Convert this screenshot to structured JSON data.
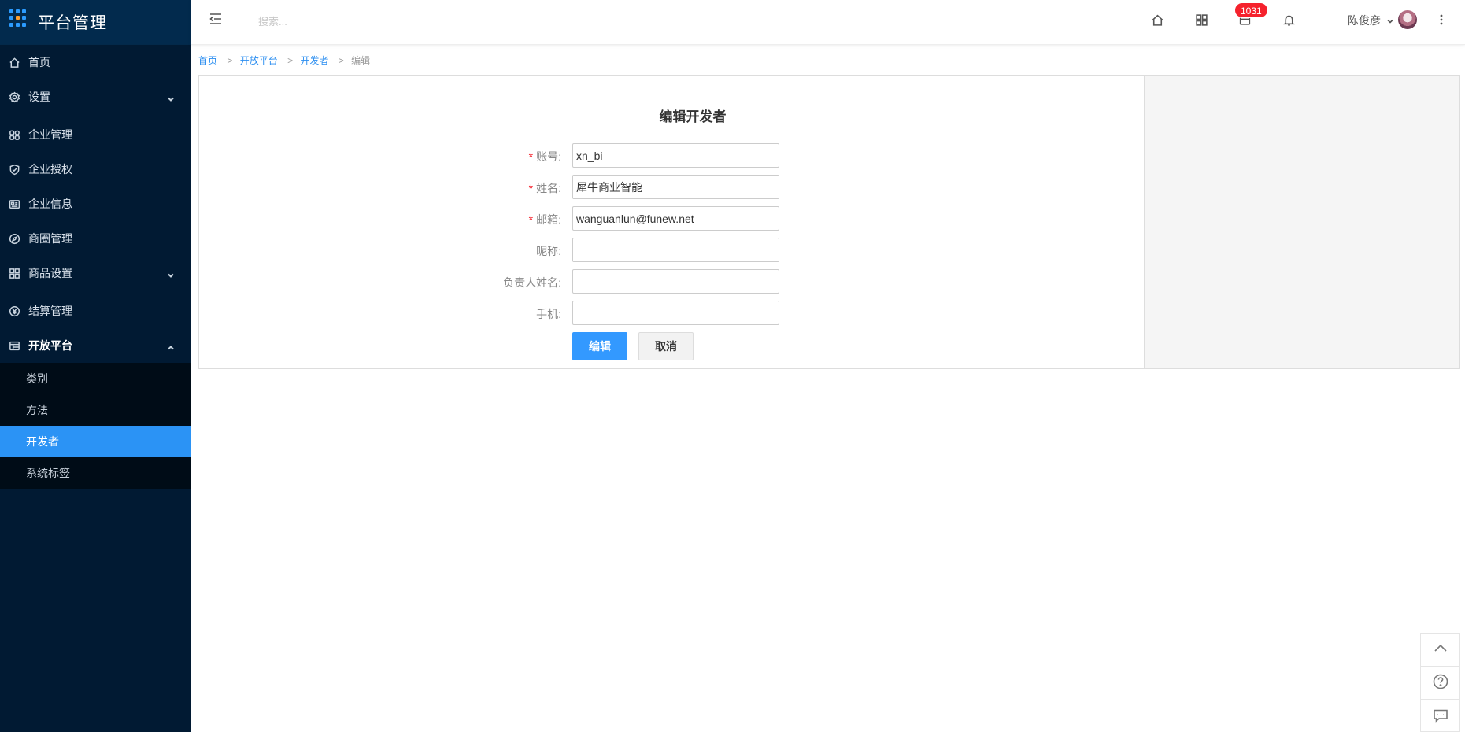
{
  "brand": {
    "title": "平台管理"
  },
  "sidebar": {
    "items": [
      {
        "label": "首页",
        "icon": "home-icon"
      },
      {
        "label": "设置",
        "icon": "gear-icon"
      },
      {
        "label": "企业管理",
        "icon": "enterprise-icon"
      },
      {
        "label": "企业授权",
        "icon": "shield-check-icon"
      },
      {
        "label": "企业信息",
        "icon": "id-card-icon"
      },
      {
        "label": "商圈管理",
        "icon": "compass-icon"
      },
      {
        "label": "商品设置",
        "icon": "grid-icon"
      },
      {
        "label": "结算管理",
        "icon": "yuan-icon"
      },
      {
        "label": "开放平台",
        "icon": "table-icon"
      }
    ],
    "open_submenu": [
      {
        "label": "类别"
      },
      {
        "label": "方法"
      },
      {
        "label": "开发者"
      },
      {
        "label": "系统标签"
      }
    ]
  },
  "header": {
    "search_placeholder": "搜索...",
    "badge_count": "1031",
    "user_name": "陈俊彦"
  },
  "breadcrumb": {
    "items": [
      "首页",
      "开放平台",
      "开发者"
    ],
    "current": "编辑",
    "separator": ">"
  },
  "form": {
    "title": "编辑开发者",
    "fields": [
      {
        "label": "账号:",
        "value": "xn_bi",
        "required": true
      },
      {
        "label": "姓名:",
        "value": "犀牛商业智能",
        "required": true
      },
      {
        "label": "邮箱:",
        "value": "wanguanlun@funew.net",
        "required": true
      },
      {
        "label": "昵称:",
        "value": "",
        "required": false
      },
      {
        "label": "负责人姓名:",
        "value": "",
        "required": false
      },
      {
        "label": "手机:",
        "value": "",
        "required": false
      }
    ],
    "required_mark": "*",
    "submit_label": "编辑",
    "cancel_label": "取消"
  },
  "colors": {
    "sidebar_bg": "#011a33",
    "active_item": "#2b93f5",
    "primary_button": "#3399ff",
    "badge": "#f5222d",
    "link": "#2b8ef0"
  }
}
